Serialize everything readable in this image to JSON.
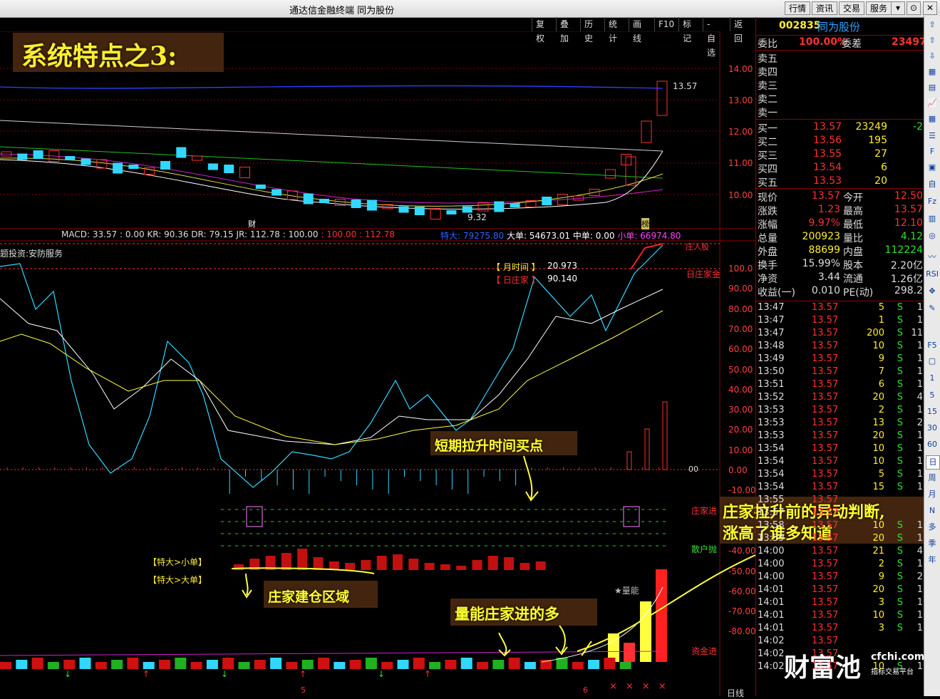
{
  "window": {
    "title": "通达信金融终端  同为股份",
    "menu": [
      "行情",
      "资讯",
      "交易",
      "服务"
    ]
  },
  "chart_menu": [
    "复权",
    "叠加",
    "历史",
    "统计",
    "画线",
    "F10",
    "标记",
    "-自选",
    "返回"
  ],
  "headline": "系统特点之3:",
  "price_axis": [
    "14.00",
    "13.00",
    "12.00",
    "11.00",
    "10.00"
  ],
  "price_labels": {
    "high": "13.57",
    "low": "9.32",
    "marker_cai": "财",
    "marker_bang": "榜"
  },
  "indicator_bar": {
    "macd": "MACD: 33.57",
    "kr": ": 0.00  KR: 90.36  DR: 79.15  JR: 112.78  : 100.00",
    "v100": ": 100.00",
    "v11278": ": 112.78",
    "tedai": "特大: 79275.80",
    "dadan": "大单: 54673.01",
    "zhongdan": "中单: 0.00",
    "xiaodan": "小单: 66974.80"
  },
  "concept_text": "题投资:安防服务",
  "legend_month": "【 月时间 】",
  "legend_month_val": "20.973",
  "legend_day": "【 日庄家 】",
  "legend_day_val": "90.140",
  "ind_axis": [
    "100.0",
    "90.00",
    "80.00",
    "70.00",
    "60.00",
    "50.00",
    "40.00",
    "30.00",
    "20.00",
    "10.00",
    "0.00",
    "-10.00",
    "-20.00",
    "-30.00",
    "-40.00",
    "-50.00",
    "-60.00",
    "-70.00",
    "-80.00"
  ],
  "ind_labels": {
    "zhuang_ru": "庄入股",
    "ri_zhuangjia": "日庄家金",
    "zero": "00",
    "zhuangjia_jin": "庄家进",
    "sanhu_pao": "散户抛",
    "zijin_jin": "资金进",
    "liangneng": "★量能",
    "ri_xian": "日线"
  },
  "bracket_labels": {
    "small": "【特大>小单】",
    "big": "【特大>大单】"
  },
  "annotations": {
    "short_term": "短期拉升时间买点",
    "build_zone": "庄家建仓区域",
    "volume": "量能庄家进的多",
    "abnormal": "庄家拉升前的异动判断,",
    "everyone_knows": "涨高了谁多知道"
  },
  "date_ticks": [
    "5",
    "6"
  ],
  "x_marks": [
    "×",
    "×",
    "×",
    "×"
  ],
  "quote": {
    "code": "002835",
    "name": "同为股份",
    "weibi_label": "委比",
    "weibi": "100.00%",
    "weicha_label": "委差",
    "weicha": "23497",
    "sell": [
      "卖五",
      "卖四",
      "卖三",
      "卖二",
      "卖一"
    ],
    "buy": [
      {
        "label": "买一",
        "price": "13.57",
        "vol": "23249",
        "chg": "-2"
      },
      {
        "label": "买二",
        "price": "13.56",
        "vol": "195",
        "chg": ""
      },
      {
        "label": "买三",
        "price": "13.55",
        "vol": "27",
        "chg": ""
      },
      {
        "label": "买四",
        "price": "13.54",
        "vol": "6",
        "chg": ""
      },
      {
        "label": "买五",
        "price": "13.53",
        "vol": "20",
        "chg": ""
      }
    ],
    "stats": [
      {
        "l1": "现价",
        "v1": "13.57",
        "l2": "今开",
        "v2": "12.50"
      },
      {
        "l1": "涨跌",
        "v1": "1.23",
        "l2": "最高",
        "v2": "13.57"
      },
      {
        "l1": "涨幅",
        "v1": "9.97%",
        "l2": "最低",
        "v2": "12.10"
      },
      {
        "l1": "总量",
        "v1": "200923",
        "l2": "量比",
        "v2": "4.12"
      },
      {
        "l1": "外盘",
        "v1": "88699",
        "l2": "内盘",
        "v2": "112224"
      },
      {
        "l1": "换手",
        "v1": "15.99%",
        "l2": "股本",
        "v2": "2.20亿"
      },
      {
        "l1": "净资",
        "v1": "3.44",
        "l2": "流通",
        "v2": "1.26亿"
      },
      {
        "l1": "收益(一)",
        "v1": "0.010",
        "l2": "PE(动)",
        "v2": "298.2"
      }
    ],
    "ticks": [
      {
        "t": "13:47",
        "p": "13.57",
        "v": "5",
        "s": "S",
        "n": "1"
      },
      {
        "t": "13:47",
        "p": "13.57",
        "v": "1",
        "s": "S",
        "n": "1"
      },
      {
        "t": "13:47",
        "p": "13.57",
        "v": "200",
        "s": "S",
        "n": "11"
      },
      {
        "t": "13:48",
        "p": "13.57",
        "v": "10",
        "s": "S",
        "n": "1"
      },
      {
        "t": "13:49",
        "p": "13.57",
        "v": "9",
        "s": "S",
        "n": "1"
      },
      {
        "t": "13:50",
        "p": "13.57",
        "v": "7",
        "s": "S",
        "n": "1"
      },
      {
        "t": "13:51",
        "p": "13.57",
        "v": "6",
        "s": "S",
        "n": "1"
      },
      {
        "t": "13:52",
        "p": "13.57",
        "v": "20",
        "s": "S",
        "n": "4"
      },
      {
        "t": "13:53",
        "p": "13.57",
        "v": "2",
        "s": "S",
        "n": "1"
      },
      {
        "t": "13:53",
        "p": "13.57",
        "v": "13",
        "s": "S",
        "n": "2"
      },
      {
        "t": "13:53",
        "p": "13.57",
        "v": "20",
        "s": "S",
        "n": "1"
      },
      {
        "t": "13:54",
        "p": "13.57",
        "v": "10",
        "s": "S",
        "n": "1"
      },
      {
        "t": "13:54",
        "p": "13.57",
        "v": "10",
        "s": "S",
        "n": "1"
      },
      {
        "t": "13:54",
        "p": "13.57",
        "v": "5",
        "s": "S",
        "n": "1"
      },
      {
        "t": "13:54",
        "p": "13.57",
        "v": "15",
        "s": "S",
        "n": "1"
      },
      {
        "t": "13:55",
        "p": "13.57",
        "v": "",
        "s": "",
        "n": ""
      },
      {
        "t": "13:57",
        "p": "13.57",
        "v": "",
        "s": "",
        "n": ""
      },
      {
        "t": "13:58",
        "p": "13.57",
        "v": "10",
        "s": "S",
        "n": "1"
      },
      {
        "t": "13:59",
        "p": "13.57",
        "v": "20",
        "s": "S",
        "n": "1"
      },
      {
        "t": "14:00",
        "p": "13.57",
        "v": "21",
        "s": "S",
        "n": "4"
      },
      {
        "t": "14:00",
        "p": "13.57",
        "v": "2",
        "s": "S",
        "n": "1"
      },
      {
        "t": "14:00",
        "p": "13.57",
        "v": "9",
        "s": "S",
        "n": "2"
      },
      {
        "t": "14:01",
        "p": "13.57",
        "v": "20",
        "s": "S",
        "n": "1"
      },
      {
        "t": "14:01",
        "p": "13.57",
        "v": "3",
        "s": "S",
        "n": "1"
      },
      {
        "t": "14:01",
        "p": "13.57",
        "v": "10",
        "s": "S",
        "n": "1"
      },
      {
        "t": "14:01",
        "p": "13.57",
        "v": "3",
        "s": "S",
        "n": "1"
      },
      {
        "t": "14:02",
        "p": "13.57",
        "v": "",
        "s": "",
        "n": ""
      },
      {
        "t": "14:02",
        "p": "13.57",
        "v": "",
        "s": "",
        "n": ""
      },
      {
        "t": "14:02",
        "p": "13.57",
        "v": "10",
        "s": "S",
        "n": "1"
      }
    ]
  },
  "watermark": {
    "brand": "财富池",
    "site": "cfchi.com",
    "sub": "指标交易平台"
  },
  "side_tools": [
    "1",
    "5",
    "15",
    "30",
    "60",
    "日",
    "周",
    "月",
    "N",
    "多",
    "季",
    "年"
  ],
  "colors": {
    "up": "#ff3030",
    "down": "#30e0ff",
    "yellow": "#ffff40",
    "green": "#30e030",
    "accent": "#ff4040"
  }
}
